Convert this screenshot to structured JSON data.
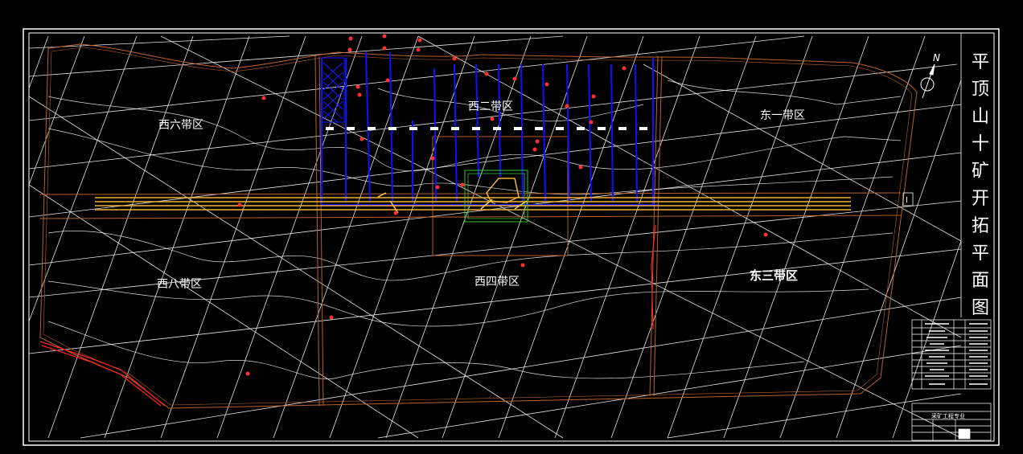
{
  "drawing": {
    "zones": [
      {
        "id": "west6",
        "label": "西六带区",
        "bold": false
      },
      {
        "id": "west2",
        "label": "西二带区",
        "bold": false
      },
      {
        "id": "east1",
        "label": "东一带区",
        "bold": false
      },
      {
        "id": "west8",
        "label": "西八带区",
        "bold": false
      },
      {
        "id": "west4",
        "label": "西四带区",
        "bold": false
      },
      {
        "id": "east3",
        "label": "东三带区",
        "bold": true
      }
    ],
    "title_chars": [
      "平",
      "顶",
      "山",
      "十",
      "矿",
      "开",
      "拓",
      "平",
      "面",
      "图"
    ],
    "north_label": "N",
    "section_mark": "I",
    "title_block_caption": "采矿工程专业",
    "colors": {
      "background": "#000000",
      "frame": "#ffffff",
      "grid": "#ffffff",
      "boundary": "#b8612c",
      "roadway": "#1010ff",
      "main_haulage": "#f2b233",
      "fault": "#ff2020",
      "shaft_area": "#39c43a"
    }
  }
}
